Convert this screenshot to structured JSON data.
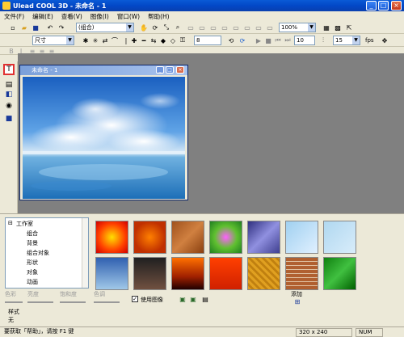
{
  "app": {
    "title": "Ulead COOL 3D - 未命名 - 1"
  },
  "menu": [
    "文件(F)",
    "编辑(E)",
    "查看(V)",
    "图像(I)",
    "窗口(W)",
    "帮助(H)"
  ],
  "toolbar1": {
    "object_select": "(组合)",
    "zoom": "100%"
  },
  "toolbar2": {
    "size_select": "尺寸",
    "frame_value": "8",
    "frames_value": "10",
    "fps_value": "15",
    "fps_label": "fps"
  },
  "document": {
    "title": "未命名 - 1"
  },
  "tree": {
    "root": "工作室",
    "items": [
      "组合",
      "背景",
      "组合对象",
      "形状",
      "对象",
      "动画"
    ]
  },
  "controls": {
    "labels": [
      "色彩",
      "亮度",
      "饱和度",
      "色调"
    ],
    "use_image": "使用图像",
    "add": "添加"
  },
  "style": {
    "label": "样式",
    "value": "无"
  },
  "status": {
    "help": "要获取「帮助」，请按 F1 键",
    "size": "320 x 240",
    "mode": "NUM"
  },
  "colors": {
    "titlebar": "#0248c7",
    "highlight": "#e03030",
    "workspace": "#808080"
  }
}
